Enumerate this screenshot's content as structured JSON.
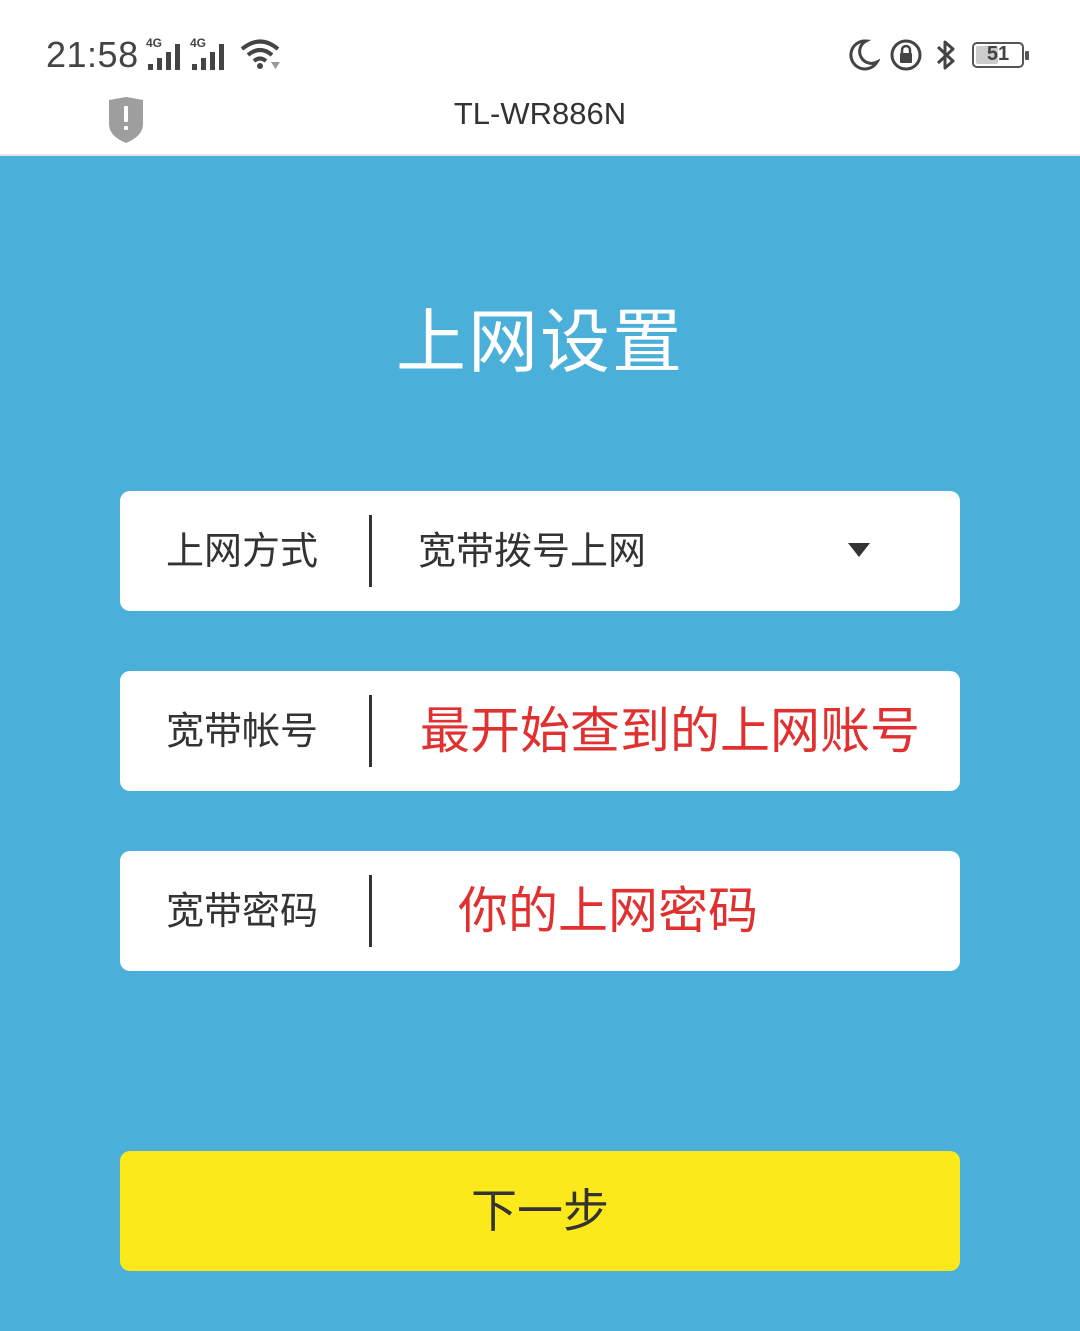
{
  "status_bar": {
    "time": "21:58",
    "sim1_network": "4G",
    "sim2_network": "4G",
    "battery_level": "51",
    "icons": [
      "signal-icon",
      "signal-icon",
      "wifi-icon",
      "moon-icon",
      "rotation-lock-icon",
      "bluetooth-icon",
      "battery-icon"
    ]
  },
  "browser": {
    "title": "TL-WR886N",
    "security_icon": "shield-warning-icon"
  },
  "page": {
    "title": "上网设置",
    "connection_type": {
      "label": "上网方式",
      "value": "宽带拨号上网"
    },
    "account": {
      "label": "宽带帐号",
      "value": "最开始查到的上网账号"
    },
    "password": {
      "label": "宽带密码",
      "value": "你的上网密码"
    },
    "next_button": "下一步"
  },
  "colors": {
    "background": "#4bb0d9",
    "button": "#fbe91c",
    "annotation_text": "#e0302f"
  }
}
